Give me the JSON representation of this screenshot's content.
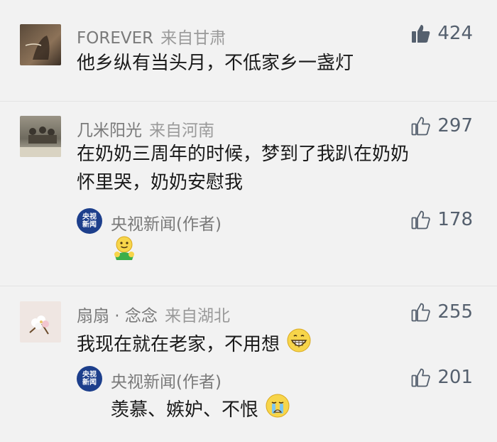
{
  "comments": [
    {
      "user": "FOREVER",
      "location": "来自甘肃",
      "text": "他乡纵有当头月，不低家乡一盏灯",
      "likes": "424",
      "liked": true
    },
    {
      "user": "几米阳光",
      "location": "来自河南",
      "text_line1": "在奶奶三周年的时候，梦到了我趴在奶奶",
      "text_line2": "怀里哭，奶奶安慰我",
      "likes": "297",
      "reply": {
        "avatar_text_top": "央视",
        "avatar_text_bottom": "新闻",
        "user": "央视新闻(作者)",
        "likes": "178",
        "emoji": "hug-emoji"
      }
    },
    {
      "user": "扇扇 · 念念",
      "location": "来自湖北",
      "text": "我现在就在老家，不用想",
      "likes": "255",
      "emoji": "grinning-emoji",
      "reply": {
        "avatar_text_top": "央视",
        "avatar_text_bottom": "新闻",
        "user": "央视新闻(作者)",
        "text": "羡慕、嫉妒、不恨",
        "likes": "201",
        "emoji": "crying-emoji"
      }
    }
  ],
  "colors": {
    "background": "#f2f2f2",
    "like_filled": "#55606e",
    "author_badge": "#1d3f8c"
  }
}
